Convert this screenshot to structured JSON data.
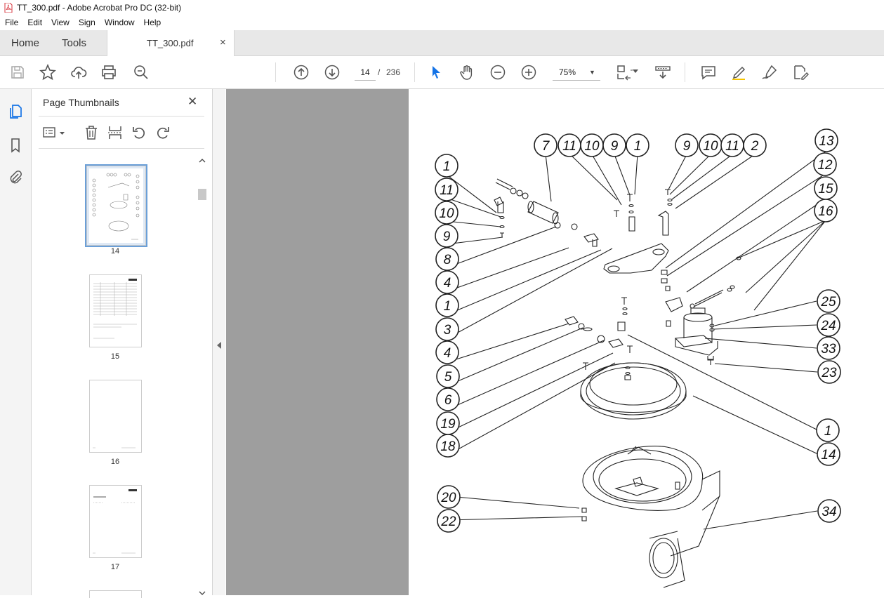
{
  "window": {
    "title": "TT_300.pdf - Adobe Acrobat Pro DC (32-bit)"
  },
  "menu": [
    "File",
    "Edit",
    "View",
    "Sign",
    "Window",
    "Help"
  ],
  "tabs": {
    "home": "Home",
    "tools": "Tools",
    "document": "TT_300.pdf",
    "close": "×"
  },
  "nav": {
    "current_page": "14",
    "separator": "/",
    "total_pages": "236",
    "zoom": "75%",
    "zoom_caret": "▼"
  },
  "panel": {
    "title": "Page Thumbnails",
    "close": "✕"
  },
  "thumbnails": [
    {
      "page": "14"
    },
    {
      "page": "15"
    },
    {
      "page": "16"
    },
    {
      "page": "17"
    }
  ],
  "diagram_labels": [
    "7",
    "11",
    "10",
    "9",
    "1",
    "9",
    "10",
    "11",
    "2",
    "13",
    "12",
    "15",
    "16",
    "1",
    "11",
    "10",
    "9",
    "8",
    "4",
    "1",
    "3",
    "4",
    "5",
    "6",
    "19",
    "18",
    "25",
    "24",
    "33",
    "23",
    "1",
    "14",
    "20",
    "22",
    "34"
  ],
  "colors": {
    "accent": "#1473e6",
    "pdf_red": "#d7373f"
  }
}
